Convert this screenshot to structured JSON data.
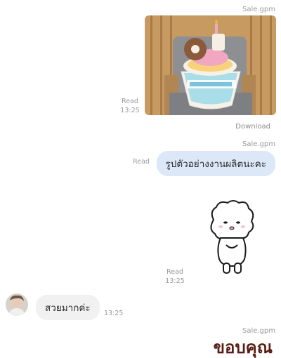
{
  "messages": {
    "m1": {
      "sender": "Sale.gpm",
      "read_label": "Read",
      "time": "13:25",
      "download_label": "Download"
    },
    "m2": {
      "sender": "Sale.gpm",
      "read_label": "Read",
      "text": "รูปตัวอย่างงานผลิตนะคะ"
    },
    "m3": {
      "read_label": "Read",
      "time": "13:25"
    },
    "m4": {
      "text": "สวยมากค่ะ",
      "time": "13:25"
    },
    "m5": {
      "sender": "Sale.gpm",
      "text": "ขอบคุณ"
    }
  },
  "colors": {
    "outgoing_bubble": "#dce7f7",
    "incoming_bubble": "#f1f1f1",
    "meta_text": "#9a9a9a"
  },
  "icons": [
    "cupcake-pillow-photo",
    "sheep-sticker",
    "avatar-photo"
  ]
}
